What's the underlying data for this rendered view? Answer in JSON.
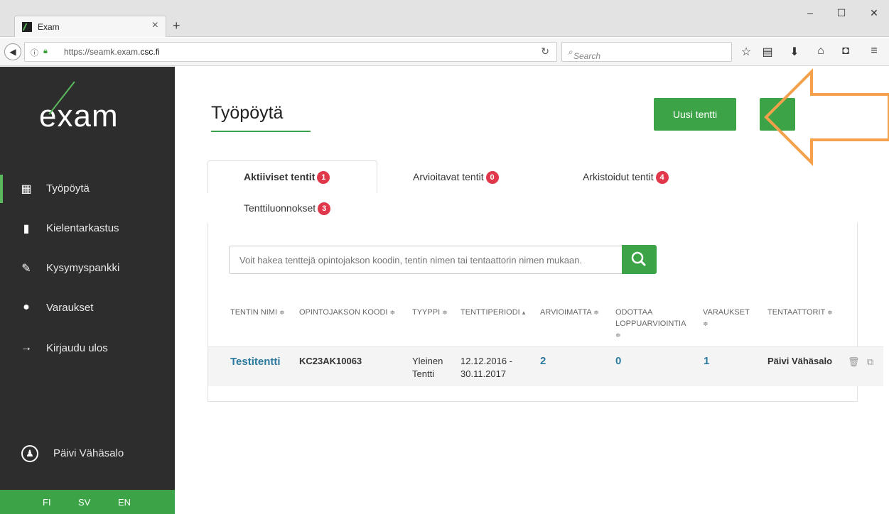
{
  "browser": {
    "tab_title": "Exam",
    "tab_close": "×",
    "new_tab": "+",
    "url_host_prefix": "https://seamk.exam.",
    "url_host_domain": "csc.fi",
    "search_placeholder": "Search",
    "window_min": "–",
    "window_max": "☐",
    "window_close": "✕"
  },
  "sidebar": {
    "logo_e": "e",
    "logo_x": "x",
    "logo_am": "am",
    "items": [
      {
        "label": "Työpöytä",
        "icon": "dashboard-icon",
        "glyph": "▦"
      },
      {
        "label": "Kielentarkastus",
        "icon": "book-icon",
        "glyph": "▮"
      },
      {
        "label": "Kysymyspankki",
        "icon": "pencil-icon",
        "glyph": "✎"
      },
      {
        "label": "Varaukset",
        "icon": "user-icon",
        "glyph": "●"
      },
      {
        "label": "Kirjaudu ulos",
        "icon": "arrow-right-icon",
        "glyph": "→"
      }
    ],
    "user_name": "Päivi Vähäsalo",
    "languages": [
      "FI",
      "SV",
      "EN"
    ]
  },
  "main": {
    "title": "Työpöytä",
    "new_exam_button": "Uusi tentti",
    "tabs": [
      {
        "label": "Aktiiviset tentit",
        "count": "1"
      },
      {
        "label": "Arvioitavat tentit",
        "count": "0"
      },
      {
        "label": "Arkistoidut tentit",
        "count": "4"
      },
      {
        "label": "Tenttiluonnokset",
        "count": "3"
      }
    ],
    "search_placeholder": "Voit hakea tenttejä opintojakson koodin, tentin nimen tai tentaattorin nimen mukaan.",
    "columns": [
      {
        "label": "TENTIN NIMI",
        "sort": "≑"
      },
      {
        "label": "OPINTOJAKSON KOODI",
        "sort": "≑"
      },
      {
        "label": "TYYPPI",
        "sort": "≑"
      },
      {
        "label": "TENTTIPERIODI",
        "sort": "▴"
      },
      {
        "label": "ARVIOIMATTA",
        "sort": "≑"
      },
      {
        "label": "ODOTTAA LOPPUARVIOINTIA",
        "sort": "≑"
      },
      {
        "label": "VARAUKSET",
        "sort": "≑"
      },
      {
        "label": "TENTAATTORIT",
        "sort": "≑"
      }
    ],
    "rows": [
      {
        "name": "Testitentti",
        "code": "KC23AK10063",
        "type_line1": "Yleinen",
        "type_line2": "Tentti",
        "period_line1": "12.12.2016 -",
        "period_line2": "30.11.2017",
        "ungraded": "2",
        "awaiting_final": "0",
        "reservations": "1",
        "examiners": "Päivi Vähäsalo"
      }
    ]
  },
  "colors": {
    "accent_green": "#3ca447",
    "badge_red": "#e0384a",
    "annotation_orange": "#f5a04a",
    "sidebar_bg": "#2d2d2d"
  }
}
